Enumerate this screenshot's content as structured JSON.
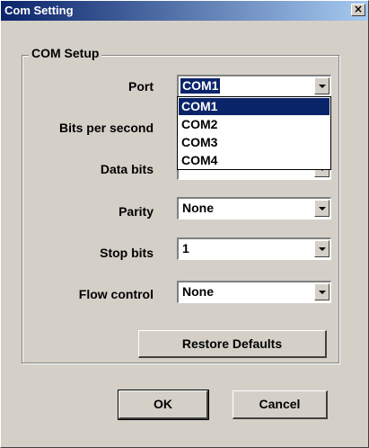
{
  "window": {
    "title": "Com Setting",
    "close_icon": "close-icon",
    "close_glyph": "×"
  },
  "group": {
    "label": "COM Setup"
  },
  "fields": {
    "port": {
      "label": "Port",
      "value": "COM1"
    },
    "bits_per_second": {
      "label": "Bits per second"
    },
    "data_bits": {
      "label": "Data bits"
    },
    "parity": {
      "label": "Parity",
      "value": "None"
    },
    "stop_bits": {
      "label": "Stop bits",
      "value": "1"
    },
    "flow_control": {
      "label": "Flow control",
      "value": "None"
    }
  },
  "port_dropdown": {
    "options": [
      "COM1",
      "COM2",
      "COM3",
      "COM4"
    ],
    "highlighted_option": "COM1"
  },
  "buttons": {
    "restore_defaults": "Restore Defaults",
    "ok": "OK",
    "cancel": "Cancel"
  },
  "colors": {
    "titlebar_start": "#0a246a",
    "titlebar_end": "#a6caf0",
    "face": "#d4d0c8",
    "highlight": "#0a246a"
  },
  "icons": {
    "dropdown": "chevron-down-icon"
  }
}
